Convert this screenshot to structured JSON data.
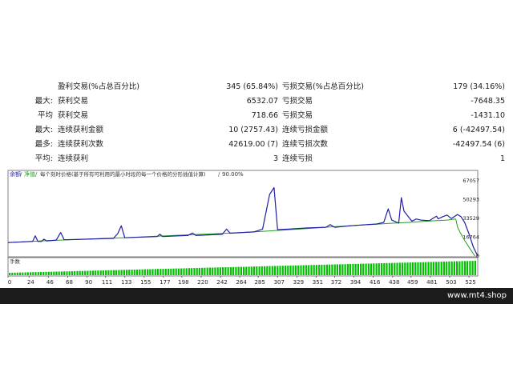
{
  "stats": {
    "rows": [
      {
        "prefix": "",
        "label": "盈利交易(%占总百分比)",
        "value": "345 (65.84%)",
        "label2": "亏损交易(%占总百分比)",
        "value2": "179 (34.16%)"
      },
      {
        "prefix": "最大:",
        "label": "获利交易",
        "value": "6532.07",
        "label2": "亏损交易",
        "value2": "-7648.35"
      },
      {
        "prefix": "平均",
        "label": "获利交易",
        "value": "718.66",
        "label2": "亏损交易",
        "value2": "-1431.10"
      },
      {
        "prefix": "最大:",
        "label": "连续获利金额",
        "value": "10 (2757.43)",
        "label2": "连续亏损金额",
        "value2": "6 (-42497.54)"
      },
      {
        "prefix": "最多:",
        "label": "连续获利次数",
        "value": "42619.00 (7)",
        "label2": "连续亏损次数",
        "value2": "-42497.54 (6)"
      },
      {
        "prefix": "平均:",
        "label": "连续获利",
        "value": "3",
        "label2": "连续亏损",
        "value2": "1"
      }
    ]
  },
  "chart": {
    "legend_balance": "余额",
    "legend_equity": "净值",
    "legend_sep": "/",
    "legend_text": "每个刻时价格(基于所有可利用的最小时段的每一个价格的分形插值计算)",
    "legend_quality": "90.00%",
    "volume_label": "手数",
    "colors": {
      "balance": "#1f1fa8",
      "equity": "#22a022",
      "volume": "#00c000",
      "grid": "#a0a0a0"
    }
  },
  "chart_data": {
    "type": "line",
    "x_ticks": [
      "0",
      "24",
      "46",
      "68",
      "90",
      "111",
      "133",
      "155",
      "177",
      "198",
      "220",
      "242",
      "264",
      "285",
      "307",
      "329",
      "351",
      "372",
      "394",
      "416",
      "438",
      "459",
      "481",
      "503",
      "525"
    ],
    "y_ticks": [
      "67057",
      "50293",
      "33529",
      "16764",
      "0"
    ],
    "ylim": [
      0,
      67057
    ],
    "xlim": [
      0,
      535
    ],
    "series": [
      {
        "name": "余额",
        "x": [
          0,
          25,
          35,
          45,
          55,
          70,
          80,
          110,
          130,
          160,
          190,
          220,
          250,
          280,
          300,
          320,
          340,
          360,
          380,
          400,
          420,
          440,
          460,
          480,
          500,
          510,
          512,
          515,
          520,
          525,
          530,
          532
        ],
        "y": [
          12000,
          13000,
          13400,
          13800,
          14000,
          14500,
          14700,
          15700,
          16300,
          17300,
          18300,
          19300,
          20300,
          21500,
          22500,
          23500,
          24500,
          25600,
          26500,
          27500,
          28300,
          29300,
          30100,
          31200,
          32000,
          33000,
          26000,
          21000,
          14000,
          8000,
          2000,
          0
        ]
      },
      {
        "name": "净值",
        "x": [
          0,
          28,
          31,
          34,
          38,
          41,
          44,
          55,
          60,
          64,
          120,
          125,
          129,
          133,
          170,
          173,
          176,
          205,
          210,
          214,
          244,
          249,
          253,
          280,
          290,
          298,
          303,
          307,
          320,
          340,
          362,
          367,
          372,
          390,
          410,
          420,
          428,
          433,
          437,
          445,
          448,
          451,
          455,
          460,
          465,
          470,
          480,
          485,
          488,
          490,
          495,
          500,
          505,
          512,
          516,
          520,
          525,
          530,
          535
        ],
        "y": [
          12000,
          13000,
          18000,
          13000,
          13000,
          15000,
          13500,
          14200,
          21000,
          14500,
          15700,
          20000,
          27000,
          16300,
          17300,
          19500,
          17300,
          18300,
          20500,
          18300,
          19300,
          24000,
          20300,
          21500,
          24000,
          55000,
          61000,
          23500,
          24000,
          25000,
          25600,
          28000,
          25600,
          27000,
          28000,
          28500,
          30000,
          42000,
          32000,
          29300,
          52000,
          40000,
          36000,
          31000,
          33000,
          32000,
          31500,
          34000,
          35500,
          33200,
          35000,
          36500,
          33400,
          37000,
          35000,
          30000,
          20000,
          8000,
          0
        ]
      },
      {
        "name": "手数",
        "values": [
          "increasing from 1 to 15 per trade, shown as bars"
        ]
      }
    ]
  },
  "footer": {
    "site": "www.mt4.shop"
  }
}
